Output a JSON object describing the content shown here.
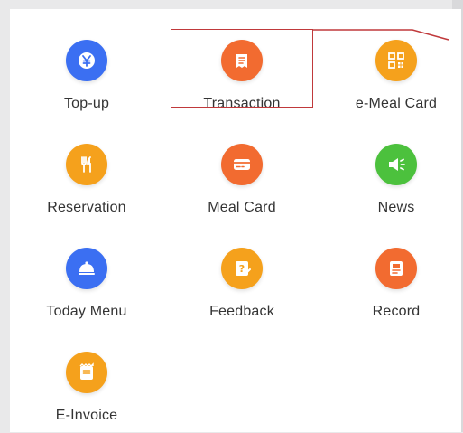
{
  "menu": {
    "items": [
      {
        "label": "Top-up",
        "icon": "yuan-coin-icon",
        "color": "#3b6ff2"
      },
      {
        "label": "Transaction",
        "icon": "receipt-icon",
        "color": "#f26b30"
      },
      {
        "label": "e-Meal Card",
        "icon": "qr-code-icon",
        "color": "#f5a11c"
      },
      {
        "label": "Reservation",
        "icon": "fork-knife-icon",
        "color": "#f5a11c"
      },
      {
        "label": "Meal Card",
        "icon": "card-icon",
        "color": "#f26b30"
      },
      {
        "label": "News",
        "icon": "megaphone-icon",
        "color": "#4cc13d"
      },
      {
        "label": "Today Menu",
        "icon": "food-cloche-icon",
        "color": "#3b6ff2"
      },
      {
        "label": "Feedback",
        "icon": "feedback-icon",
        "color": "#f5a11c"
      },
      {
        "label": "Record",
        "icon": "record-icon",
        "color": "#f26b30"
      },
      {
        "label": "E-Invoice",
        "icon": "invoice-icon",
        "color": "#f5a11c"
      }
    ]
  },
  "annotation": {
    "highlight_color": "#c0393b",
    "highlighted_item": "Transaction"
  }
}
